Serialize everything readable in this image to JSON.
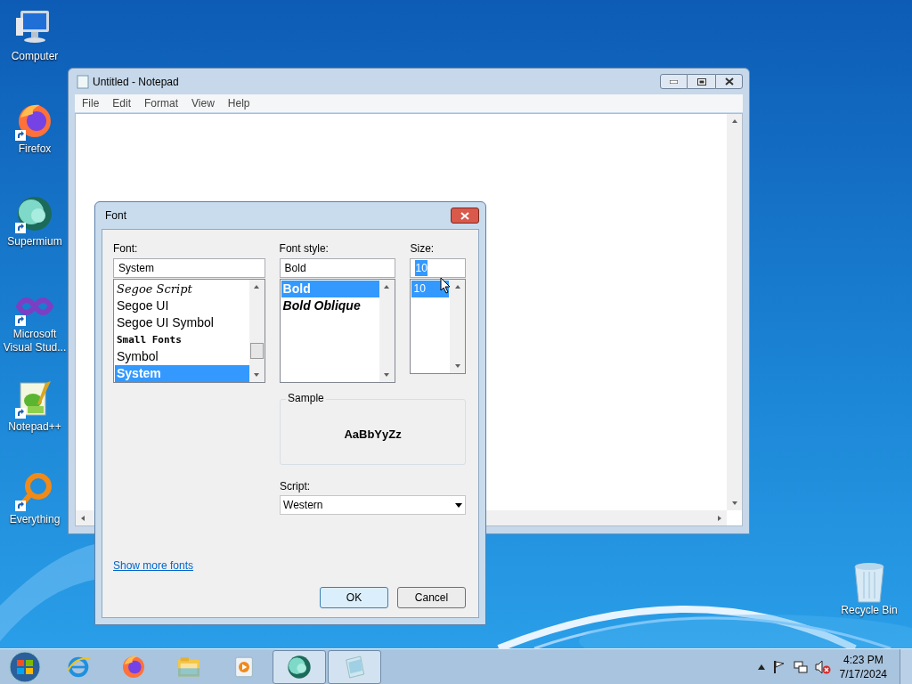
{
  "desktop_icons": [
    {
      "kind": "computer",
      "label": "Computer",
      "shortcut": false
    },
    {
      "kind": "firefox",
      "label": "Firefox",
      "shortcut": true
    },
    {
      "kind": "supermium",
      "label": "Supermium",
      "shortcut": true
    },
    {
      "kind": "visualstudio",
      "label": "Microsoft Visual Stud...",
      "shortcut": true
    },
    {
      "kind": "notepadpp",
      "label": "Notepad++",
      "shortcut": true
    },
    {
      "kind": "everything",
      "label": "Everything",
      "shortcut": true
    }
  ],
  "recycle_bin": {
    "label": "Recycle Bin"
  },
  "notepad": {
    "title": "Untitled - Notepad",
    "menu": [
      "File",
      "Edit",
      "Format",
      "View",
      "Help"
    ]
  },
  "font_dialog": {
    "title": "Font",
    "font": {
      "label": "Font:",
      "value": "System",
      "items": [
        {
          "name": "Segoe Script",
          "kind": "script",
          "selected": false
        },
        {
          "name": "Segoe UI",
          "kind": "regular",
          "selected": false
        },
        {
          "name": "Segoe UI Symbol",
          "kind": "regular",
          "selected": false
        },
        {
          "name": "Small Fonts",
          "kind": "pixel",
          "selected": false
        },
        {
          "name": "Symbol",
          "kind": "regular",
          "selected": false
        },
        {
          "name": "System",
          "kind": "bold",
          "selected": true
        }
      ]
    },
    "style": {
      "label": "Font style:",
      "value": "Bold",
      "items": [
        {
          "name": "Bold",
          "kind": "bold",
          "selected": true
        },
        {
          "name": "Bold Oblique",
          "kind": "bolditalic",
          "selected": false
        }
      ]
    },
    "size": {
      "label": "Size:",
      "value": "10",
      "value_selected": true,
      "items": [
        {
          "name": "10",
          "kind": "small",
          "selected": true
        }
      ]
    },
    "sample": {
      "label": "Sample",
      "text": "AaBbYyZz"
    },
    "script": {
      "label": "Script:",
      "value": "Western"
    },
    "link": "Show more fonts",
    "buttons": [
      {
        "label": "OK",
        "default": true
      },
      {
        "label": "Cancel",
        "default": false
      }
    ]
  },
  "taskbar": {
    "items": [
      {
        "kind": "ie",
        "active": false
      },
      {
        "kind": "firefox",
        "active": false
      },
      {
        "kind": "explorer",
        "active": false
      },
      {
        "kind": "mediaplayer",
        "active": false
      },
      {
        "kind": "supermium",
        "active": true
      },
      {
        "kind": "notepad",
        "active": true
      }
    ],
    "time": "4:23 PM",
    "date": "7/17/2024"
  }
}
